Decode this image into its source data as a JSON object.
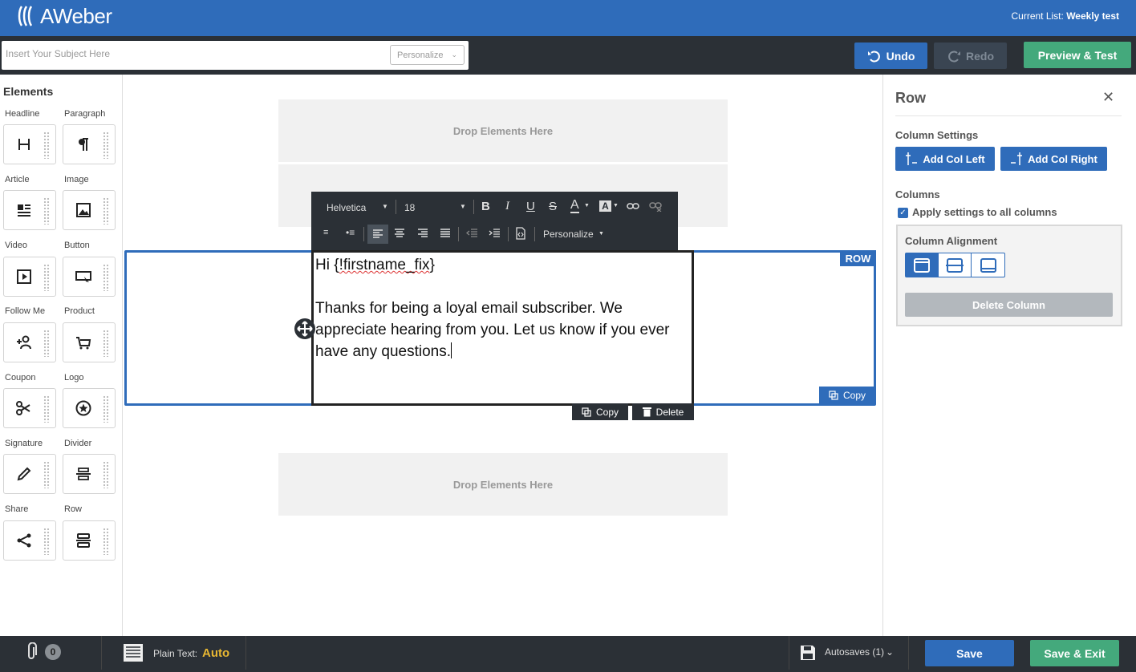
{
  "header": {
    "brand": "AWeber",
    "current_list_label": "Current List:",
    "current_list_value": "Weekly test"
  },
  "subject": {
    "placeholder": "Insert Your Subject Here",
    "personalize_label": "Personalize"
  },
  "actions": {
    "undo": "Undo",
    "redo": "Redo",
    "preview": "Preview & Test"
  },
  "sidebar": {
    "title": "Elements",
    "items": [
      {
        "label": "Headline",
        "icon": "headline-icon"
      },
      {
        "label": "Paragraph",
        "icon": "paragraph-icon"
      },
      {
        "label": "Article",
        "icon": "article-icon"
      },
      {
        "label": "Image",
        "icon": "image-icon"
      },
      {
        "label": "Video",
        "icon": "video-icon"
      },
      {
        "label": "Button",
        "icon": "button-icon"
      },
      {
        "label": "Follow Me",
        "icon": "follow-me-icon"
      },
      {
        "label": "Product",
        "icon": "product-cart-icon"
      },
      {
        "label": "Coupon",
        "icon": "coupon-scissors-icon"
      },
      {
        "label": "Logo",
        "icon": "logo-star-icon"
      },
      {
        "label": "Signature",
        "icon": "signature-pen-icon"
      },
      {
        "label": "Divider",
        "icon": "divider-icon"
      },
      {
        "label": "Share",
        "icon": "share-icon"
      },
      {
        "label": "Row",
        "icon": "row-icon"
      }
    ]
  },
  "canvas": {
    "drop_top": "Drop Elements Here",
    "drop_bottom": "Drop Elements Here",
    "row_tag": "ROW",
    "row_copy": "Copy",
    "block_copy": "Copy",
    "block_delete": "Delete",
    "text_line1_prefix": "Hi {",
    "text_line1_fix": "!firstname_fix",
    "text_line1_suffix": "}",
    "text_para": "Thanks for being a loyal email subscriber. We appreciate hearing from you. Let us know if you ever have any questions."
  },
  "toolbar": {
    "font": "Helvetica",
    "size": "18",
    "personalize": "Personalize"
  },
  "right_panel": {
    "title": "Row",
    "column_settings": "Column Settings",
    "add_col_left": "Add Col Left",
    "add_col_right": "Add Col Right",
    "columns": "Columns",
    "apply_all": "Apply settings to all columns",
    "apply_all_checked": true,
    "column_alignment": "Column Alignment",
    "delete_column": "Delete Column"
  },
  "footer": {
    "attachments_count": "0",
    "plain_text_label": "Plain Text:",
    "plain_text_value": "Auto",
    "autosaves": "Autosaves (1)",
    "save": "Save",
    "save_exit": "Save & Exit"
  },
  "colors": {
    "brand_blue": "#2f6cba",
    "dark_bar": "#2b3036",
    "green": "#44a97c",
    "auto_yellow": "#e8b732"
  }
}
